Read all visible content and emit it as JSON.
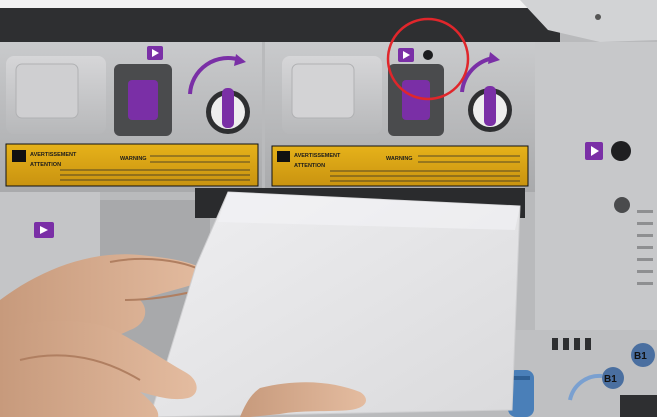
{
  "scene": {
    "subject": "printer",
    "highlight_color": "#e0262b",
    "accent_color": "#7a2fa6"
  },
  "warning_labels": [
    {
      "heading": "AVERTISSEMENT",
      "warning_word": "WARNING",
      "caution_word": "ATTENTION"
    },
    {
      "heading": "AVERTISSEMENT",
      "warning_word": "WARNING",
      "caution_word": "ATTENTION"
    }
  ],
  "lock_marks": {
    "unlock": "⊡",
    "lock": "⊟"
  },
  "tags": {
    "b1_left": "B1",
    "b1_right": "B1"
  }
}
